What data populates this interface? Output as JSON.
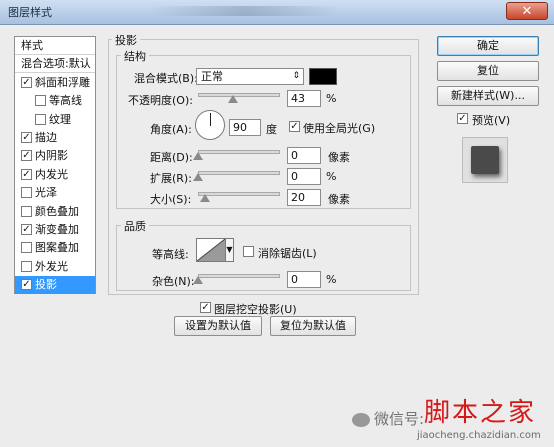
{
  "window": {
    "title": "图层样式",
    "close_symbol": "✕"
  },
  "left_panel": {
    "items": [
      {
        "label": "样式",
        "checkbox": false,
        "checked": false,
        "indent": false,
        "selected": false,
        "bordered": true
      },
      {
        "label": "混合选项:默认",
        "checkbox": false,
        "checked": false,
        "indent": false,
        "selected": false,
        "bordered": true
      },
      {
        "label": "斜面和浮雕",
        "checkbox": true,
        "checked": true,
        "indent": false,
        "selected": false,
        "bordered": false
      },
      {
        "label": "等高线",
        "checkbox": true,
        "checked": false,
        "indent": true,
        "selected": false,
        "bordered": false
      },
      {
        "label": "纹理",
        "checkbox": true,
        "checked": false,
        "indent": true,
        "selected": false,
        "bordered": false
      },
      {
        "label": "描边",
        "checkbox": true,
        "checked": true,
        "indent": false,
        "selected": false,
        "bordered": false
      },
      {
        "label": "内阴影",
        "checkbox": true,
        "checked": true,
        "indent": false,
        "selected": false,
        "bordered": false
      },
      {
        "label": "内发光",
        "checkbox": true,
        "checked": true,
        "indent": false,
        "selected": false,
        "bordered": false
      },
      {
        "label": "光泽",
        "checkbox": true,
        "checked": false,
        "indent": false,
        "selected": false,
        "bordered": false
      },
      {
        "label": "颜色叠加",
        "checkbox": true,
        "checked": false,
        "indent": false,
        "selected": false,
        "bordered": false
      },
      {
        "label": "渐变叠加",
        "checkbox": true,
        "checked": true,
        "indent": false,
        "selected": false,
        "bordered": false
      },
      {
        "label": "图案叠加",
        "checkbox": true,
        "checked": false,
        "indent": false,
        "selected": false,
        "bordered": false
      },
      {
        "label": "外发光",
        "checkbox": true,
        "checked": false,
        "indent": false,
        "selected": false,
        "bordered": false
      },
      {
        "label": "投影",
        "checkbox": true,
        "checked": true,
        "indent": false,
        "selected": true,
        "bordered": false
      }
    ]
  },
  "drop_shadow": {
    "section_title": "投影",
    "structure": {
      "title": "结构",
      "blend_mode_label": "混合模式(B):",
      "blend_mode_value": "正常",
      "blend_color": "#000000",
      "opacity_label": "不透明度(O):",
      "opacity_value": "43",
      "opacity_unit": "%",
      "angle_label": "角度(A):",
      "angle_value": "90",
      "angle_unit": "度",
      "global_light_label": "使用全局光(G)",
      "global_light_checked": true,
      "distance_label": "距离(D):",
      "distance_value": "0",
      "distance_unit": "像素",
      "spread_label": "扩展(R):",
      "spread_value": "0",
      "spread_unit": "%",
      "size_label": "大小(S):",
      "size_value": "20",
      "size_unit": "像素"
    },
    "quality": {
      "title": "品质",
      "contour_label": "等高线:",
      "anti_alias_label": "消除锯齿(L)",
      "anti_alias_checked": false,
      "noise_label": "杂色(N):",
      "noise_value": "0",
      "noise_unit": "%"
    },
    "knockout_label": "图层挖空投影(U)",
    "knockout_checked": true,
    "make_default_label": "设置为默认值",
    "reset_default_label": "复位为默认值"
  },
  "buttons": {
    "ok": "确定",
    "reset": "复位",
    "new_style": "新建样式(W)...",
    "preview_label": "预览(V)",
    "preview_checked": true
  },
  "watermark": {
    "wechat_text": "微信号:",
    "site_name": "脚本之家",
    "site_url": "jiaocheng.chazidian.com"
  },
  "check_mark": "✓"
}
